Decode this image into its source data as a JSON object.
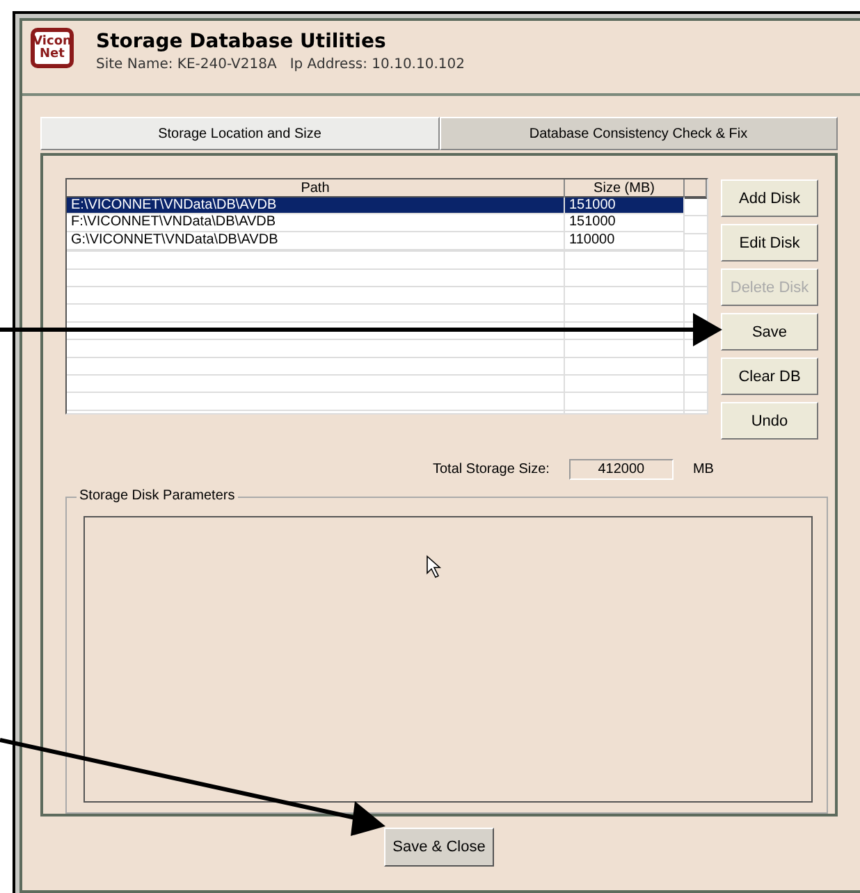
{
  "window": {
    "logo": [
      "Vicon",
      "Net"
    ],
    "title": "Storage Database Utilities",
    "subtitle": "Site Name: KE-240-V218A   Ip Address: 10.10.10.102"
  },
  "tabs": [
    {
      "label": "Storage Location and Size",
      "selected": true
    },
    {
      "label": "Database Consistency Check & Fix",
      "selected": false
    }
  ],
  "table": {
    "columns": [
      "Path",
      "Size (MB)"
    ],
    "rows": [
      {
        "path": "E:\\VICONNET\\VNData\\DB\\AVDB",
        "size": "151000",
        "selected": true
      },
      {
        "path": "F:\\VICONNET\\VNData\\DB\\AVDB",
        "size": "151000",
        "selected": false
      },
      {
        "path": "G:\\VICONNET\\VNData\\DB\\AVDB",
        "size": "110000",
        "selected": false
      }
    ]
  },
  "buttons": [
    {
      "label": "Add Disk",
      "disabled": false
    },
    {
      "label": "Edit Disk",
      "disabled": false
    },
    {
      "label": "Delete Disk",
      "disabled": true
    },
    {
      "label": "Save",
      "disabled": false
    },
    {
      "label": "Clear DB",
      "disabled": false
    },
    {
      "label": "Undo",
      "disabled": false
    }
  ],
  "total": {
    "label": "Total Storage Size:",
    "value": "412000",
    "unit": "MB"
  },
  "group": {
    "title": "Storage Disk Parameters"
  },
  "footer_button": "Save & Close"
}
